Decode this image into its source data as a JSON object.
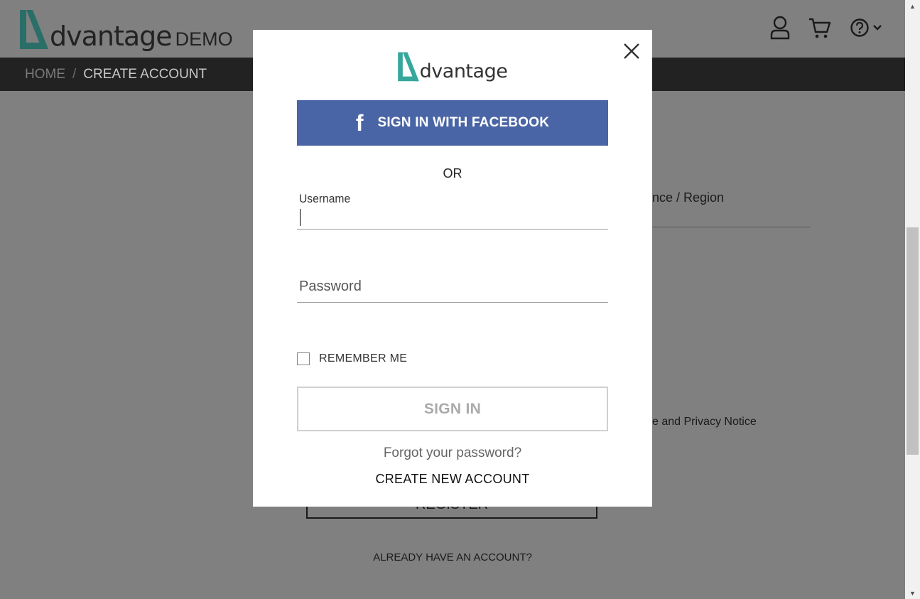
{
  "header": {
    "logo_word": "dvantage",
    "logo_suffix": "DEMO"
  },
  "breadcrumb": {
    "home": "HOME",
    "separator": "/",
    "current": "CREATE ACCOUNT"
  },
  "background_form": {
    "region_label": "nce / Region",
    "privacy_text": "e and Privacy Notice",
    "register_button": "REGISTER",
    "already_link": "ALREADY HAVE AN ACCOUNT?"
  },
  "modal": {
    "logo_word": "dvantage",
    "facebook_icon_glyph": "f",
    "facebook_button": "SIGN IN WITH FACEBOOK",
    "or_text": "OR",
    "username_label": "Username",
    "username_value": "",
    "password_placeholder": "Password",
    "remember_me": "REMEMBER ME",
    "sign_in_button": "SIGN IN",
    "forgot_link": "Forgot your password?",
    "create_account_link": "CREATE NEW ACCOUNT"
  },
  "icons": {
    "user": "user-icon",
    "cart": "cart-icon",
    "help": "help-icon",
    "dropdown": "chevron-down-icon",
    "close": "close-icon",
    "facebook": "facebook-icon"
  },
  "colors": {
    "brand_teal": "#2d8f86",
    "facebook_blue": "#4a65a6",
    "overlay_gray": "#808080",
    "nav_dark": "#222222"
  }
}
